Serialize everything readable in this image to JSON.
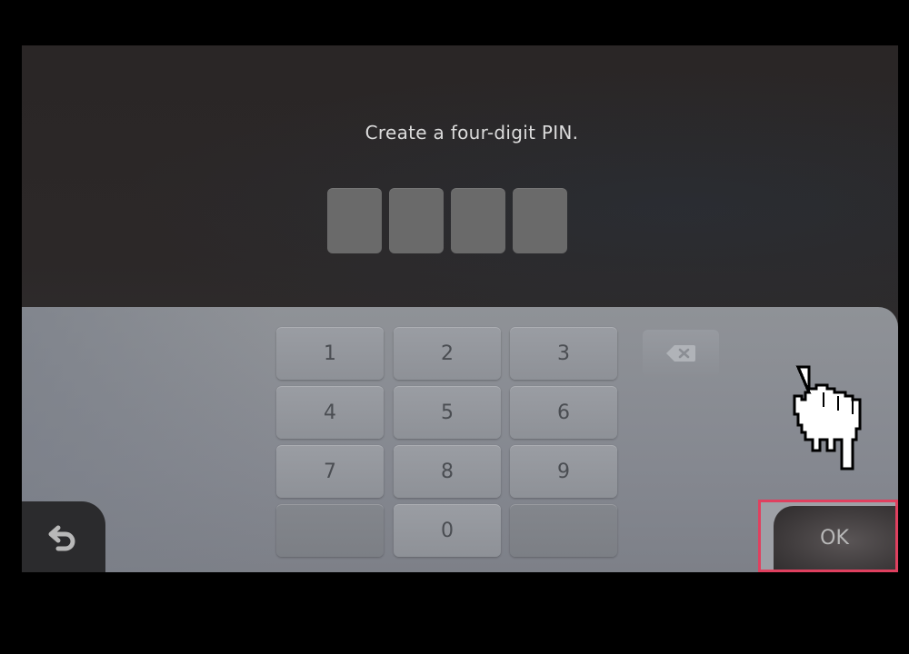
{
  "prompt": "Create a four-digit PIN.",
  "pin": {
    "length": 4,
    "entered": [
      "",
      "",
      "",
      ""
    ]
  },
  "keypad": {
    "keys": [
      "1",
      "2",
      "3",
      "4",
      "5",
      "6",
      "7",
      "8",
      "9",
      "",
      "0",
      ""
    ]
  },
  "buttons": {
    "ok_label": "OK",
    "back_icon": "back-arrow-icon",
    "backspace_icon": "backspace-icon"
  },
  "cursor": {
    "icon": "pointing-hand-icon"
  },
  "colors": {
    "highlight_border": "#e0405f",
    "screen_bg": "#2b2828",
    "keypad_bg": "#8a8d93",
    "pin_box": "#6a6a6a"
  }
}
